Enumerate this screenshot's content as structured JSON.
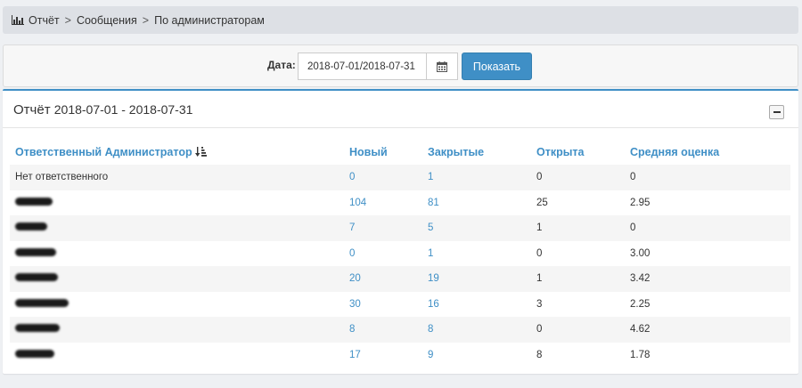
{
  "breadcrumb": {
    "icon": "bar-chart-icon",
    "items": [
      "Отчёт",
      "Сообщения",
      "По администраторам"
    ],
    "separator": ">"
  },
  "filter": {
    "date_label": "Дата:",
    "date_value": "2018-07-01/2018-07-31",
    "calendar_icon": "calendar-icon",
    "show_label": "Показать"
  },
  "report": {
    "title_prefix": "Отчёт",
    "title_range": "2018-07-01 - 2018-07-31",
    "collapse_icon": "minus-icon",
    "columns": [
      "Ответственный Администратор",
      "Новый",
      "Закрытые",
      "Открыта",
      "Средняя оценка"
    ],
    "rows": [
      {
        "admin": "Нет ответственного",
        "new": "0",
        "closed": "1",
        "open": "0",
        "rating": "0"
      },
      {
        "admin": "",
        "new": "104",
        "closed": "81",
        "open": "25",
        "rating": "2.95"
      },
      {
        "admin": "",
        "new": "7",
        "closed": "5",
        "open": "1",
        "rating": "0"
      },
      {
        "admin": "",
        "new": "0",
        "closed": "1",
        "open": "0",
        "rating": "3.00"
      },
      {
        "admin": "",
        "new": "20",
        "closed": "19",
        "open": "1",
        "rating": "3.42"
      },
      {
        "admin": "",
        "new": "30",
        "closed": "16",
        "open": "3",
        "rating": "2.25"
      },
      {
        "admin": "",
        "new": "8",
        "closed": "8",
        "open": "0",
        "rating": "4.62"
      },
      {
        "admin": "",
        "new": "17",
        "closed": "9",
        "open": "8",
        "rating": "1.78"
      }
    ]
  }
}
